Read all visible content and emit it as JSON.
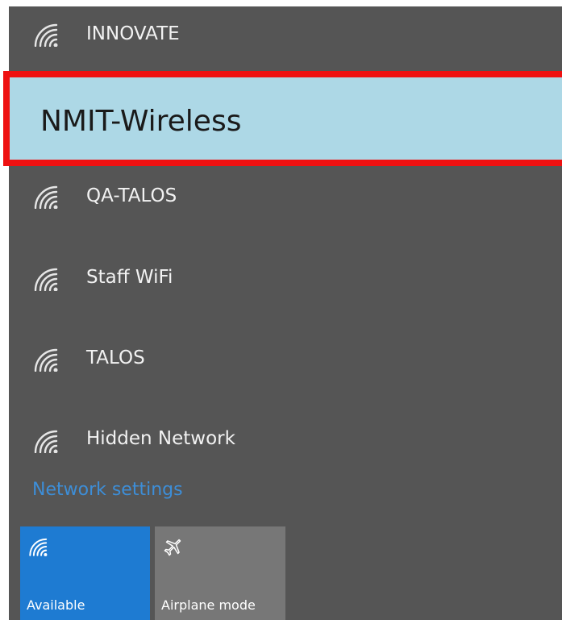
{
  "networks": [
    {
      "name": "INNOVATE",
      "icon": "wifi-icon"
    },
    {
      "name": "NMIT-Wireless",
      "selected": true,
      "highlight_color": "#add8e6",
      "outline_color": "#ee1111"
    },
    {
      "name": "QA-TALOS",
      "icon": "wifi-icon"
    },
    {
      "name": "Staff WiFi",
      "icon": "wifi-icon"
    },
    {
      "name": "TALOS",
      "icon": "wifi-icon"
    },
    {
      "name": "Hidden Network",
      "icon": "wifi-icon"
    }
  ],
  "network_settings_label": "Network settings",
  "quick_actions": {
    "wifi": {
      "label": "Available",
      "icon": "wifi-icon",
      "color": "#1e7bd2"
    },
    "airplane": {
      "label": "Airplane mode",
      "icon": "airplane-icon",
      "color": "#777777"
    }
  },
  "panel_color": "#555555"
}
